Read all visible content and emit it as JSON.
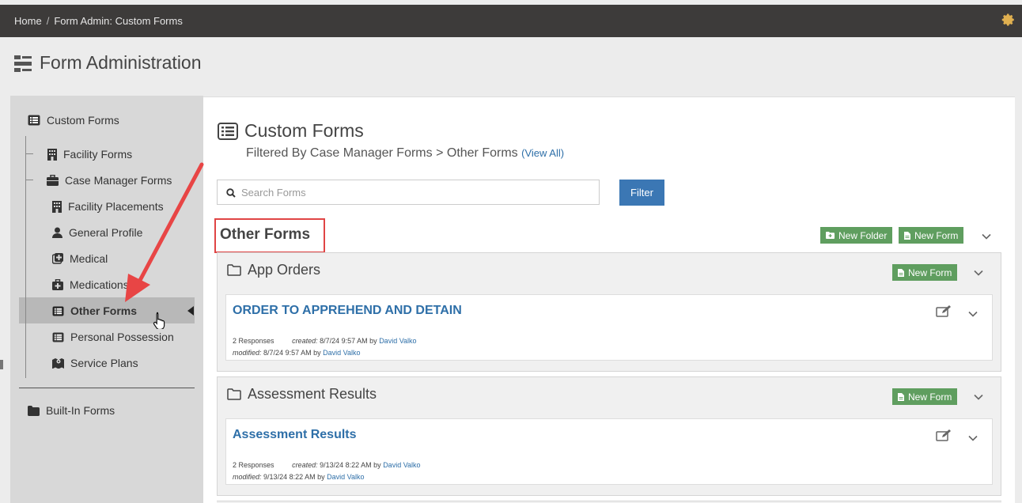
{
  "breadcrumb": {
    "home": "Home",
    "separator": "/",
    "current": "Form Admin: Custom Forms"
  },
  "page": {
    "title": "Form Administration"
  },
  "sidebar": {
    "root": "Custom Forms",
    "items": [
      {
        "label": "Facility Forms",
        "icon": "building-icon"
      },
      {
        "label": "Case Manager Forms",
        "icon": "briefcase-icon"
      },
      {
        "label": "Facility Placements",
        "icon": "building-icon"
      },
      {
        "label": "General Profile",
        "icon": "user-icon"
      },
      {
        "label": "Medical",
        "icon": "medical-icon"
      },
      {
        "label": "Medications",
        "icon": "medkit-icon"
      },
      {
        "label": "Other Forms",
        "icon": "list-icon",
        "active": true
      },
      {
        "label": "Personal Possession",
        "icon": "list-icon"
      },
      {
        "label": "Service Plans",
        "icon": "map-icon"
      }
    ],
    "built_in": "Built-In Forms"
  },
  "main": {
    "title": "Custom Forms",
    "filtered_text": "Filtered By Case Manager Forms > Other Forms",
    "view_all": "(View All)",
    "search_placeholder": "Search Forms",
    "filter_button": "Filter",
    "section_title": "Other Forms",
    "new_folder": "New Folder",
    "new_form": "New Form",
    "folders": [
      {
        "name": "App Orders",
        "new_form": "New Form",
        "card": {
          "title": "ORDER TO APPREHEND AND DETAIN",
          "responses": "2 Responses",
          "created_label": "created:",
          "created_date": "8/7/24 9:57 AM by",
          "created_by": "David Valko",
          "modified_label": "modified:",
          "modified_date": "8/7/24 9:57 AM by",
          "modified_by": "David Valko"
        }
      },
      {
        "name": "Assessment Results",
        "new_form": "New Form",
        "card": {
          "title": "Assessment Results",
          "responses": "2 Responses",
          "created_label": "created:",
          "created_date": "9/13/24 8:22 AM by",
          "created_by": "David Valko",
          "modified_label": "modified:",
          "modified_date": "9/13/24 8:22 AM by",
          "modified_by": "David Valko"
        }
      }
    ]
  },
  "colors": {
    "topbar": "#3d3b3a",
    "primary": "#3b77b4",
    "success": "#5f9e5f",
    "link": "#2e6fa8",
    "highlight": "#e04545",
    "gear": "#e0b050"
  }
}
